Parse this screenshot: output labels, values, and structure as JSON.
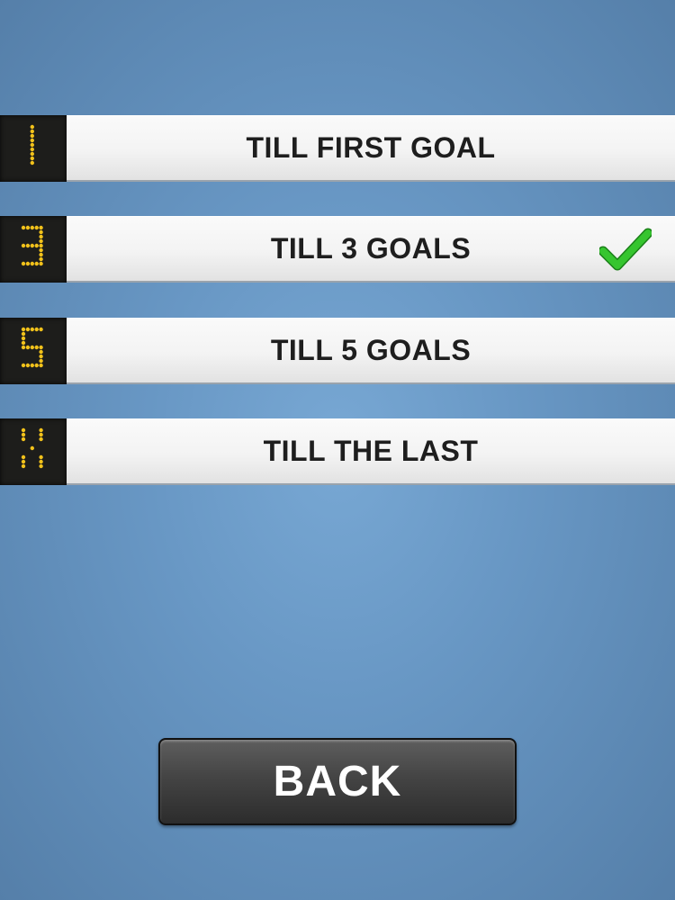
{
  "modes": [
    {
      "badge": "1",
      "label": "TILL FIRST GOAL",
      "selected": false
    },
    {
      "badge": "3",
      "label": "TILL 3 GOALS",
      "selected": true
    },
    {
      "badge": "5",
      "label": "TILL 5 GOALS",
      "selected": false
    },
    {
      "badge": "X",
      "label": "TILL THE LAST",
      "selected": false
    }
  ],
  "selected_icon": "checkmark-icon",
  "back_label": "BACK",
  "colors": {
    "background": "#6a9ac7",
    "digit_led": "#f2c21b",
    "check_green": "#2fb82a",
    "button_dark": "#3a3a3a"
  }
}
